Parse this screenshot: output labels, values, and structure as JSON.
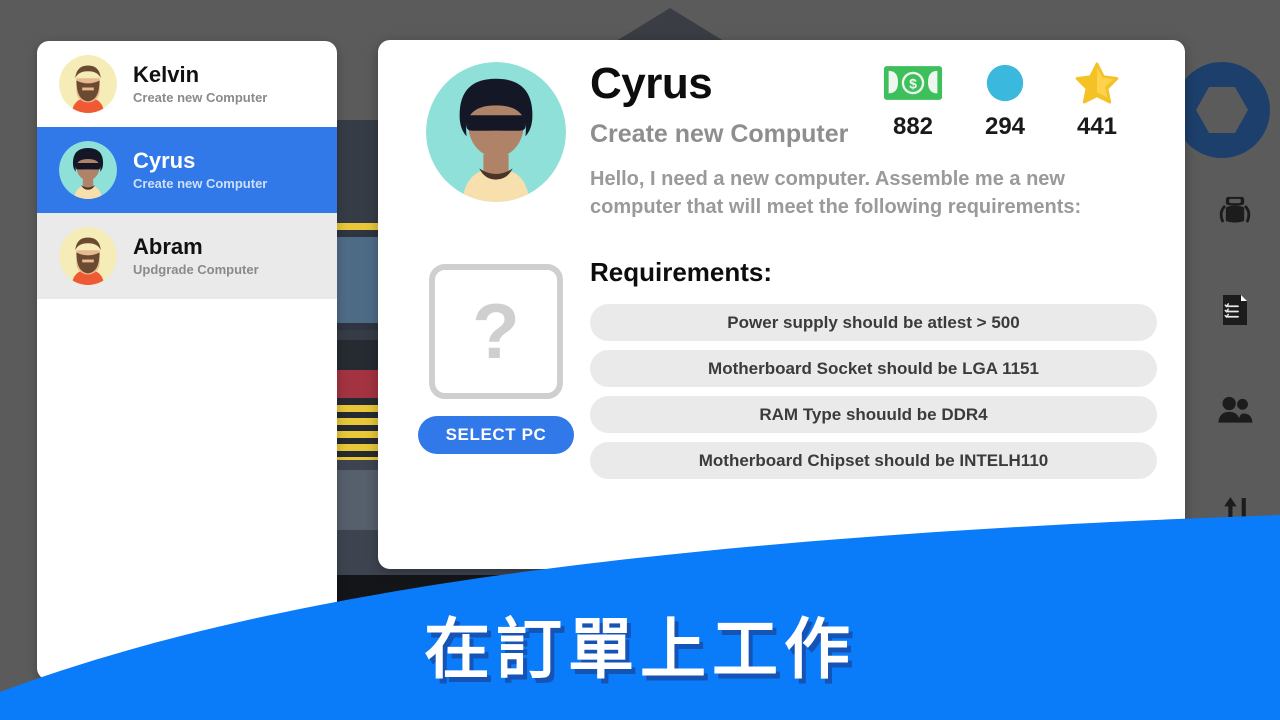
{
  "background": {
    "scene_name": "workshop-scene",
    "overlay_color": "#5b5b5b"
  },
  "customer_list": {
    "name": "customer-list",
    "items": [
      {
        "name": "Kelvin",
        "task": "Create new Computer",
        "avatar": "bearded-man",
        "state": "normal"
      },
      {
        "name": "Cyrus",
        "task": "Create new Computer",
        "avatar": "afro-sunglasses",
        "state": "selected"
      },
      {
        "name": "Abram",
        "task": "Updgrade Computer",
        "avatar": "bearded-man",
        "state": "alternate"
      }
    ]
  },
  "dialog": {
    "customer_name": "Cyrus",
    "customer_task": "Create new Computer",
    "intro_text": "Hello, I need a new computer. Assemble me a new computer that will meet the following requirements:",
    "avatar": "afro-sunglasses",
    "pc_slot_placeholder": "?",
    "select_button_label": "SELECT PC",
    "requirements_title": "Requirements:",
    "requirements": [
      "Power supply should be atlest > 500",
      "Motherboard Socket should be LGA 1151",
      "RAM Type shouuld be DDR4",
      "Motherboard Chipset should be INTELH110"
    ],
    "stats": [
      {
        "icon": "money-icon",
        "value": "882",
        "color": "#38b551"
      },
      {
        "icon": "gem-icon",
        "value": "294",
        "color": "#3bb8dd"
      },
      {
        "icon": "star-icon",
        "value": "441",
        "color": "#f5c225"
      }
    ]
  },
  "rail": {
    "logo": "hex-nut-logo-icon",
    "items": [
      {
        "icon": "robot-icon"
      },
      {
        "icon": "order-document-icon"
      },
      {
        "icon": "people-icon"
      },
      {
        "icon": "sort-arrows-icon"
      }
    ],
    "close_icon": "close-icon"
  },
  "banner": {
    "text": "在訂單上工作",
    "background_color": "#0a7cfa",
    "shadow_color": "#1553b5"
  },
  "theme": {
    "accent_blue": "#3178e8",
    "banner_blue": "#0a7cfa",
    "panel_white": "#ffffff",
    "chip_gray": "#eaeaea",
    "muted_text": "#9a9a9a"
  }
}
